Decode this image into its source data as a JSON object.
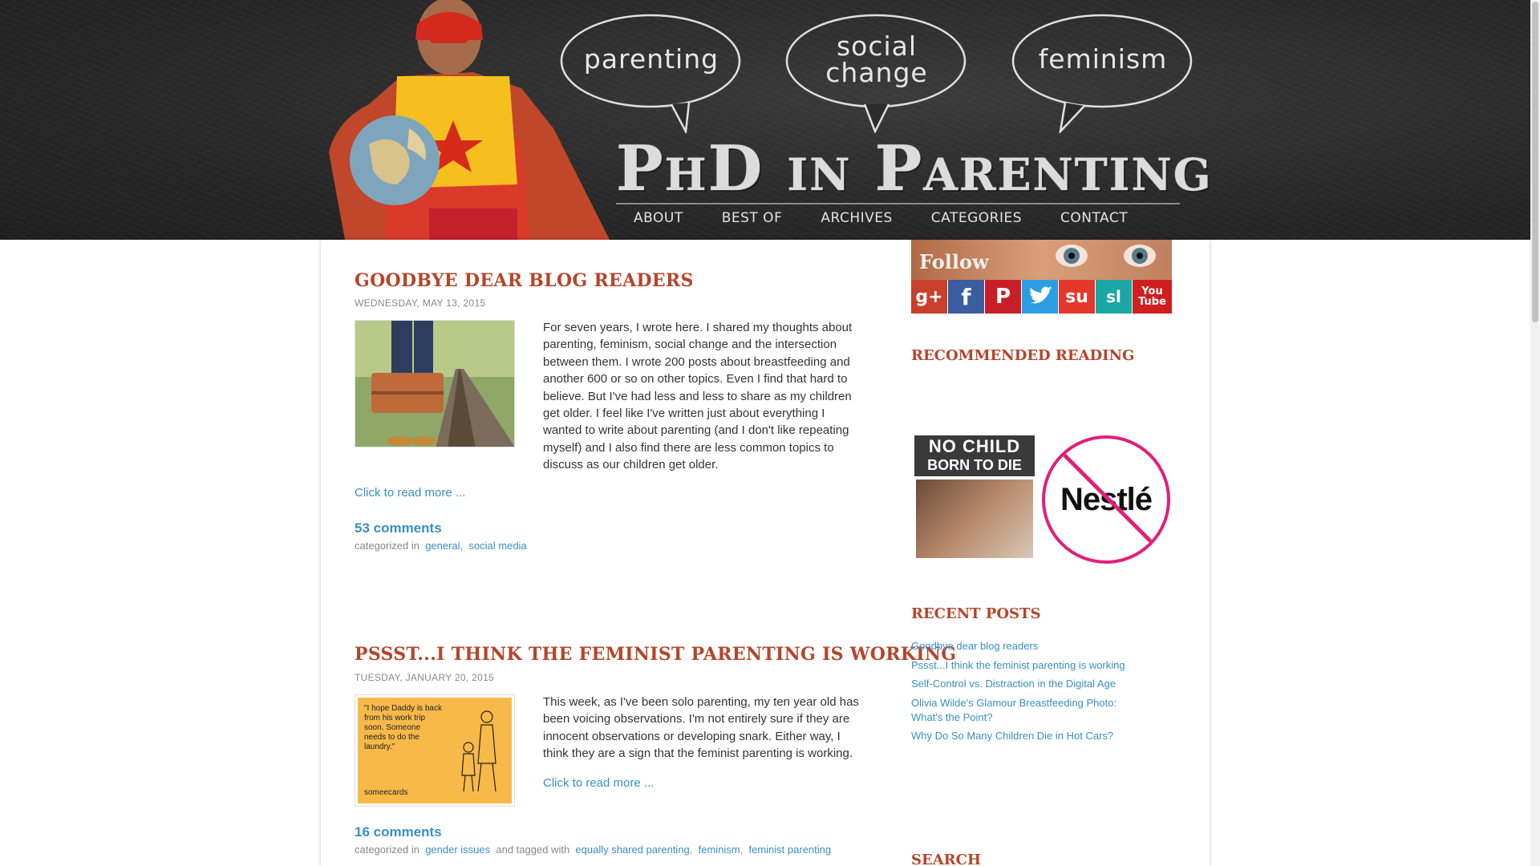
{
  "header": {
    "site_title": "PhD in Parenting",
    "bubbles": [
      "parenting",
      "social\nchange",
      "feminism"
    ],
    "nav": [
      "ABOUT",
      "BEST OF",
      "ARCHIVES",
      "CATEGORIES",
      "CONTACT"
    ]
  },
  "posts": [
    {
      "title": "GOODBYE DEAR BLOG READERS",
      "date": "WEDNESDAY, MAY 13, 2015",
      "body": "For seven years, I wrote here. I shared my thoughts about parenting, feminism, social change and the intersection between them. I wrote 200 posts about breastfeeding and another 600 or so on other topics. Even I find that hard to believe. But I've had less and less to share as my children get older. I feel like I've written just about everything I wanted to write about parenting (and I don't like repeating myself) and I also find there are less common topics to discuss as our children get older.",
      "read_more": "Click to read more ...",
      "comments": "53 comments",
      "categorized_in": "categorized in",
      "categories": [
        "general",
        "social media"
      ]
    },
    {
      "title": "PSSST...I THINK THE FEMINIST PARENTING IS WORKING",
      "date": "TUESDAY, JANUARY 20, 2015",
      "body": "This week, as I've been solo parenting, my ten year old has been voicing observations. I'm not entirely sure if they are innocent observations or developing snark. Either way, I think they are a sign that the feminist parenting is working.",
      "read_more": "Click to read more ...",
      "comments": "16 comments",
      "categorized_in": "categorized in",
      "categories": [
        "gender issues"
      ],
      "tagged_with": "and tagged with",
      "tags": [
        "equally shared parenting",
        "feminism",
        "feminist parenting"
      ],
      "ecard_text": "\"I hope Daddy is back from his work trip soon. Someone needs to do the laundry.\"",
      "ecard_brand": "someecards"
    }
  ],
  "sidebar": {
    "follow": "Follow",
    "social": [
      "g+",
      "f",
      "P",
      "twitter",
      "su",
      "sl",
      "You Tube"
    ],
    "recommended_title": "RECOMMENDED READING",
    "no_child_banner": [
      "NO CHILD",
      "BORN TO DIE"
    ],
    "nestle_text": "Nestlé",
    "recent_title": "RECENT POSTS",
    "recent_posts": [
      "Goodbye dear blog readers",
      "Pssst...I think the feminist parenting is working",
      "Self-Control vs. Distraction in the Digital Age",
      "Olivia Wilde's Glamour Breastfeeding Photo: What's the Point?",
      "Why Do So Many Children Die in Hot Cars?"
    ],
    "search_title": "SEARCH"
  },
  "colors": {
    "accent": "#b5452a",
    "link": "#3a8fc4",
    "header_bg": "#2a2a2a"
  }
}
